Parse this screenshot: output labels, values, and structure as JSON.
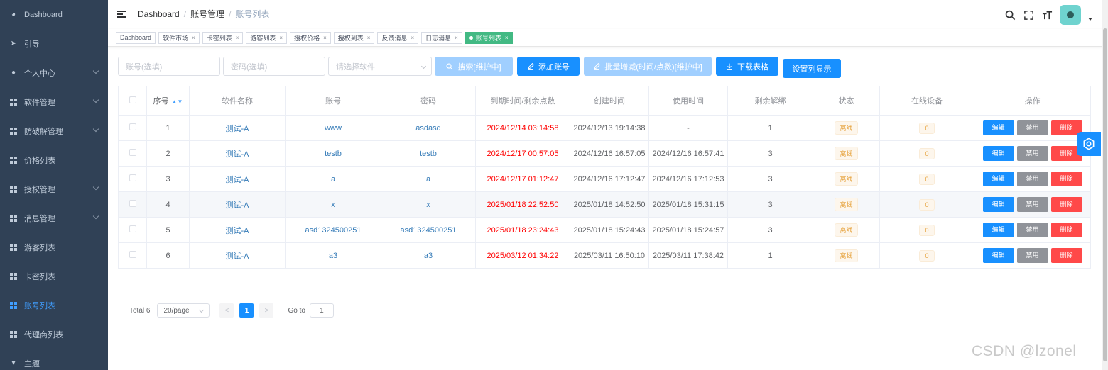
{
  "sidebar": {
    "items": [
      {
        "label": "Dashboard",
        "icon": "dashboard-icon",
        "arrow": false
      },
      {
        "label": "引导",
        "icon": "send-icon",
        "arrow": false
      },
      {
        "label": "个人中心",
        "icon": "user-icon",
        "arrow": true
      },
      {
        "label": "软件管理",
        "icon": "table-icon",
        "arrow": true
      },
      {
        "label": "防破解管理",
        "icon": "table-icon",
        "arrow": true
      },
      {
        "label": "价格列表",
        "icon": "table-icon",
        "arrow": false
      },
      {
        "label": "授权管理",
        "icon": "table-icon",
        "arrow": true
      },
      {
        "label": "消息管理",
        "icon": "table-icon",
        "arrow": true
      },
      {
        "label": "游客列表",
        "icon": "table-icon",
        "arrow": false
      },
      {
        "label": "卡密列表",
        "icon": "table-icon",
        "arrow": false
      },
      {
        "label": "账号列表",
        "icon": "table-icon",
        "arrow": false,
        "active": true
      },
      {
        "label": "代理商列表",
        "icon": "table-icon",
        "arrow": false
      },
      {
        "label": "主题",
        "icon": "shirt-icon",
        "arrow": false
      }
    ]
  },
  "header": {
    "breadcrumb": [
      "Dashboard",
      "账号管理",
      "账号列表"
    ]
  },
  "tags": [
    {
      "label": "Dashboard",
      "closable": false
    },
    {
      "label": "软件市场",
      "closable": true
    },
    {
      "label": "卡密列表",
      "closable": true
    },
    {
      "label": "游客列表",
      "closable": true
    },
    {
      "label": "授权价格",
      "closable": true
    },
    {
      "label": "授权列表",
      "closable": true
    },
    {
      "label": "反馈消息",
      "closable": true
    },
    {
      "label": "日志消息",
      "closable": true
    },
    {
      "label": "账号列表",
      "closable": true,
      "active": true
    }
  ],
  "filter": {
    "account_placeholder": "账号(选填)",
    "password_placeholder": "密码(选填)",
    "software_placeholder": "请选择软件",
    "search_label": "搜索[维护中]",
    "add_label": "添加账号",
    "batch_label": "批量增减(时间/点数)[维护中]",
    "download_label": "下载表格",
    "columns_label": "设置列显示"
  },
  "table": {
    "columns": [
      "序号",
      "软件名称",
      "账号",
      "密码",
      "到期时间/剩余点数",
      "创建时间",
      "使用时间",
      "剩余解绑",
      "状态",
      "在线设备",
      "操作"
    ],
    "rows": [
      {
        "no": "1",
        "software": "测试-A",
        "account": "www",
        "password": "asdasd",
        "expire": "2024/12/14 03:14:58",
        "created": "2024/12/13 19:14:38",
        "used": "-",
        "unbind": "1",
        "status": "离线",
        "online": "0"
      },
      {
        "no": "2",
        "software": "测试-A",
        "account": "testb",
        "password": "testb",
        "expire": "2024/12/17 00:57:05",
        "created": "2024/12/16 16:57:05",
        "used": "2024/12/16 16:57:41",
        "unbind": "3",
        "status": "离线",
        "online": "0"
      },
      {
        "no": "3",
        "software": "测试-A",
        "account": "a",
        "password": "a",
        "expire": "2024/12/17 01:12:47",
        "created": "2024/12/16 17:12:47",
        "used": "2024/12/16 17:12:53",
        "unbind": "3",
        "status": "离线",
        "online": "0"
      },
      {
        "no": "4",
        "software": "测试-A",
        "account": "x",
        "password": "x",
        "expire": "2025/01/18 22:52:50",
        "created": "2025/01/18 14:52:50",
        "used": "2025/01/18 15:31:15",
        "unbind": "3",
        "status": "离线",
        "online": "0"
      },
      {
        "no": "5",
        "software": "测试-A",
        "account": "asd1324500251",
        "password": "asd1324500251",
        "expire": "2025/01/18 23:24:43",
        "created": "2025/01/18 15:24:43",
        "used": "2025/01/18 15:24:57",
        "unbind": "3",
        "status": "离线",
        "online": "0"
      },
      {
        "no": "6",
        "software": "测试-A",
        "account": "a3",
        "password": "a3",
        "expire": "2025/03/12 01:34:22",
        "created": "2025/03/11 16:50:10",
        "used": "2025/03/11 17:38:42",
        "unbind": "1",
        "status": "离线",
        "online": "0"
      }
    ],
    "actions": {
      "edit": "编辑",
      "ban": "禁用",
      "delete": "删除"
    }
  },
  "pager": {
    "total": "Total 6",
    "page_size": "20/page",
    "current": "1",
    "goto_label": "Go to",
    "goto_value": "1"
  },
  "watermark": "CSDN @lzonel",
  "colors": {
    "sidebar_bg": "#304156",
    "primary": "#1890ff",
    "expire": "#ff0000",
    "active_tag": "#42b983"
  }
}
